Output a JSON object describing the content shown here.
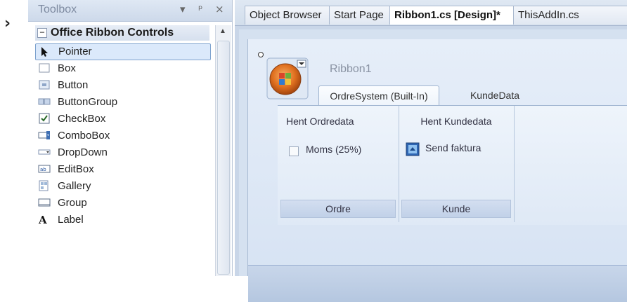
{
  "toolbox": {
    "title": "Toolbox",
    "controls": {
      "dropdown": "▾",
      "pin": "ᵖ",
      "close": "×"
    },
    "group": {
      "toggle": "−",
      "label": "Office Ribbon Controls"
    },
    "items": [
      {
        "label": "Pointer",
        "icon": "pointer-icon",
        "selected": true
      },
      {
        "label": "Box",
        "icon": "box-icon"
      },
      {
        "label": "Button",
        "icon": "button-icon"
      },
      {
        "label": "ButtonGroup",
        "icon": "buttongroup-icon"
      },
      {
        "label": "CheckBox",
        "icon": "checkbox-icon"
      },
      {
        "label": "ComboBox",
        "icon": "combobox-icon"
      },
      {
        "label": "DropDown",
        "icon": "dropdown-icon"
      },
      {
        "label": "EditBox",
        "icon": "editbox-icon"
      },
      {
        "label": "Gallery",
        "icon": "gallery-icon"
      },
      {
        "label": "Group",
        "icon": "group-icon"
      },
      {
        "label": "Label",
        "icon": "label-icon"
      }
    ]
  },
  "document_tabs": [
    {
      "label": "Object Browser"
    },
    {
      "label": "Start Page"
    },
    {
      "label": "Ribbon1.cs [Design]*",
      "active": true
    },
    {
      "label": "ThisAddIn.cs"
    }
  ],
  "ribbon": {
    "title": "Ribbon1",
    "tabs": [
      {
        "label": "OrdreSystem (Built-In)",
        "active": true
      },
      {
        "label": "KundeData"
      }
    ],
    "groups": [
      {
        "header": "Hent Ordredata",
        "checkbox_label": "Moms (25%)",
        "footer": "Ordre"
      },
      {
        "header": "Hent Kundedata",
        "button_label": "Send faktura",
        "footer": "Kunde"
      }
    ]
  },
  "colors": {
    "accent": "#dbe9fb",
    "ribbon_bg": "#e6eef9",
    "app_button": "#e8731f"
  }
}
